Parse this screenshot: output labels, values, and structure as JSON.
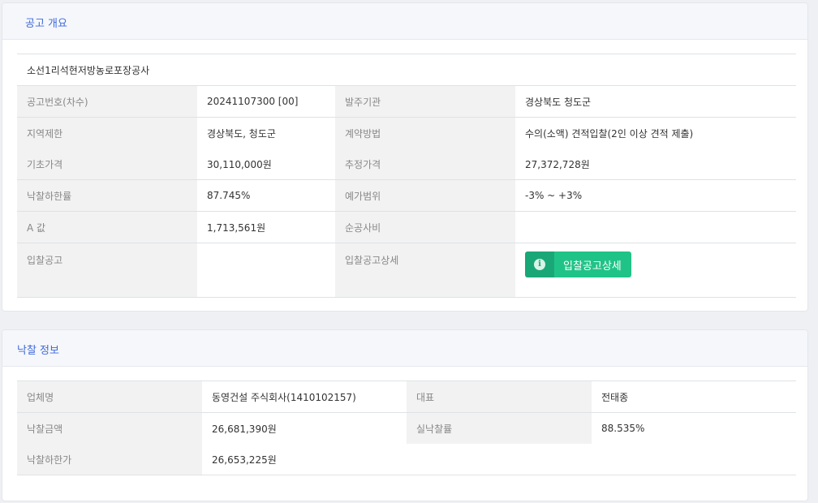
{
  "notice": {
    "header": "공고 개요",
    "title": "소선1리석현저방농로포장공사",
    "rows": [
      {
        "l1": "공고번호(차수)",
        "v1": "20241107300 [00]",
        "l2": "발주기관",
        "v2": "경상북도 청도군"
      },
      {
        "l1": "지역제한",
        "v1": "경상북도, 청도군",
        "l2": "계약방법",
        "v2": "수의(소액) 견적입찰(2인 이상 견적 제출)"
      },
      {
        "l1": "기초가격",
        "v1": "30,110,000원",
        "l2": "추정가격",
        "v2": "27,372,728원"
      },
      {
        "l1": "낙찰하한률",
        "v1": "87.745%",
        "l2": "예가범위",
        "v2": "-3% ~ +3%"
      },
      {
        "l1": "A 값",
        "v1": "1,713,561원",
        "l2": "순공사비",
        "v2": ""
      }
    ],
    "detail_row": {
      "l1": "입찰공고",
      "v1": "",
      "l2": "입찰공고상세"
    },
    "detail_button": {
      "icon": "info-icon",
      "glyph": "i",
      "label": "입찰공고상세"
    }
  },
  "award": {
    "header": "낙찰 정보",
    "rows": [
      {
        "l1": "업체명",
        "v1": "동영건설 주식회사(1410102157)",
        "l2": "대표",
        "v2": "전태종"
      },
      {
        "l1": "낙찰금액",
        "v1": "26,681,390원",
        "l2": "실낙찰률",
        "v2": "88.535%"
      },
      {
        "l1": "낙찰하한가",
        "v1": "26,653,225원"
      }
    ]
  },
  "colors": {
    "header_text": "#3f6ad8",
    "label_bg": "#f2f2f2",
    "button_bg": "#20c387",
    "button_icon_bg": "#1aa777"
  }
}
